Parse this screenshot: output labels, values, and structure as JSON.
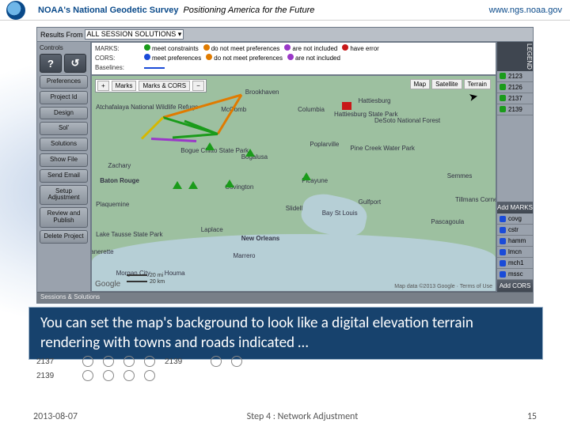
{
  "header": {
    "brand": "NOAA's National Geodetic Survey",
    "tagline": "Positioning America for the Future",
    "url": "www.ngs.noaa.gov"
  },
  "app": {
    "results_label": "Results From",
    "results_select": "ALL SESSION SOLUTIONS",
    "legend": {
      "title": "LEGEND",
      "marks_label": "MARKS:",
      "cors_label": "CORS:",
      "baselines_label": "Baselines:",
      "items": {
        "meet_constraints": "meet constraints",
        "meet_preferences": "meet preferences",
        "do_not_meet_preferences": "do not meet preferences",
        "are_not_included": "are not included",
        "have_error": "have error"
      }
    },
    "sidebar": {
      "controls_label": "Controls",
      "help_icon": "?",
      "undo_icon": "↺",
      "buttons": [
        "Preferences",
        "Project Id",
        "Design",
        "Sol'",
        "Solutions",
        "Show File",
        "Send Email",
        "Setup Adjustment",
        "Review and Publish",
        "Delete Project"
      ]
    },
    "map_toolbar": {
      "plus": "+",
      "marks": "Marks",
      "marks_cors": "Marks & CORS",
      "minus": "−"
    },
    "map_types": {
      "map": "Map",
      "satellite": "Satellite",
      "terrain": "Terrain"
    },
    "cities": {
      "brookhaven": "Brookhaven",
      "mccomb": "McComb",
      "columbia": "Columbia",
      "hattiesburg": "Hattiesburg",
      "hattiesburg_sp": "Hattiesburg State Park",
      "bogue": "Bogue Chitto State Park",
      "bogalusa": "Bogalusa",
      "poplarville": "Poplarville",
      "pinecreek": "Pine Creek Water Park",
      "covington": "Covington",
      "picayune": "Picayune",
      "slidell": "Slidell",
      "gulfport": "Gulfport",
      "baystlouis": "Bay St Louis",
      "batonrouge": "Baton Rouge",
      "zachary": "Zachary",
      "plaquemine": "Plaquemine",
      "laplace": "Laplace",
      "neworleans": "New Orleans",
      "marrero": "Marrero",
      "houma": "Houma",
      "morgancity": "Morgan City",
      "jeanerette": "Jeanerette",
      "semmes": "Semmes",
      "tillmans": "Tillmans Corner",
      "pascagoula": "Pascagoula",
      "atchafalaya": "Atchafalaya National Wildlife Refuge",
      "desoto": "DeSoto National Forest",
      "laketausse": "Lake Tausse State Park"
    },
    "attribution": {
      "google": "Google",
      "scale_mi": "20 mi",
      "scale_km": "20 km",
      "mapdata": "Map data ©2013 Google",
      "terms": "Terms of Use"
    },
    "right": {
      "add_marks": "Add MARKS",
      "add_cors": "Add CORS",
      "marks": [
        "2123",
        "2126",
        "2137",
        "2139"
      ],
      "cors": [
        "covg",
        "cstr",
        "hamm",
        "lmcn",
        "mch1",
        "mssc"
      ]
    },
    "bottom": "Sessions & Solutions"
  },
  "grid": {
    "ids": [
      "2137",
      "2139"
    ]
  },
  "caption": "You can set the map's background to look like a digital elevation terrain rendering with towns and roads indicated …",
  "footer": {
    "date": "2013-08-07",
    "step": "Step 4 : Network Adjustment",
    "page": "15"
  }
}
